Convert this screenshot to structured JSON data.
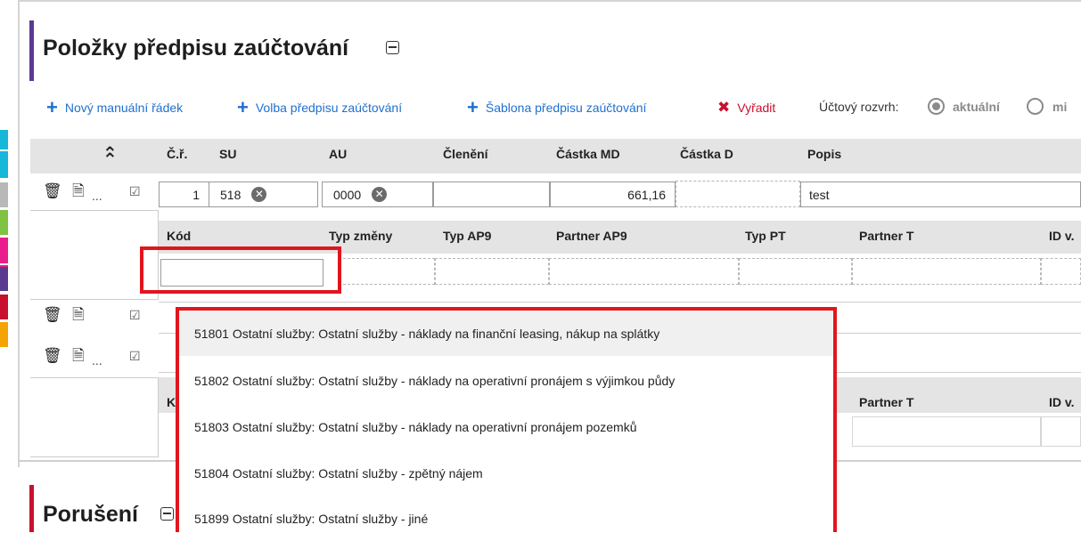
{
  "section": {
    "title": "Položky předpisu zaúčtování",
    "toolbar": {
      "new_row": "Nový manuální řádek",
      "select_rule": "Volba předpisu zaúčtování",
      "template": "Šablona předpisu zaúčtování",
      "remove": "Vyřadit",
      "chart_label": "Účtový rozvrh:",
      "radio_current": "aktuální",
      "radio_other": "mi"
    },
    "columns": {
      "row_no": "Č.ř.",
      "su": "SU",
      "au": "AU",
      "breakdown": "Členění",
      "amount_md": "Částka MD",
      "amount_d": "Částka D",
      "description": "Popis"
    },
    "row1": {
      "ellipsis": "...",
      "row_no": "1",
      "su": "518",
      "au": "0000",
      "amount_md": "661,16",
      "description": "test"
    },
    "sub_columns": {
      "code": "Kód",
      "change_type": "Typ změny",
      "ap9_type": "Typ AP9",
      "ap9_partner": "Partner AP9",
      "pt_type": "Typ PT",
      "t_partner": "Partner T",
      "id": "ID v."
    },
    "row3": {
      "ellipsis": "..."
    },
    "sub_columns2": {
      "code_partial": "K",
      "t_partner": "Partner T",
      "id": "ID v."
    }
  },
  "dropdown": {
    "items": [
      "51801 Ostatní služby: Ostatní služby - náklady na finanční leasing, nákup na splátky",
      "51802 Ostatní služby: Ostatní služby - náklady na operativní pronájem s výjimkou půdy",
      "51803 Ostatní služby: Ostatní služby - náklady na operativní pronájem pozemků",
      "51804 Ostatní služby: Ostatní služby - zpětný nájem",
      "51899 Ostatní služby: Ostatní služby - jiné"
    ]
  },
  "section2": {
    "title": "Porušení"
  },
  "colors": {
    "accent_blue": "#1f6fd0",
    "danger_red": "#c8102e",
    "highlight_red": "#e0161e",
    "title_purple": "#5a3a91",
    "strip": [
      "#16b7d8",
      "#16b7d8",
      "#b8b8b8",
      "#7dc242",
      "#e91e8c",
      "#e91e8c",
      "#5a3a91",
      "#c8102e",
      "#f5a300"
    ]
  }
}
